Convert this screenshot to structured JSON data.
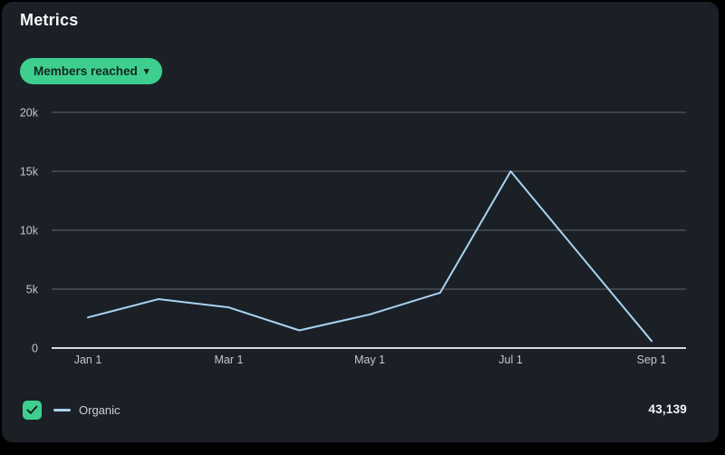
{
  "page": {
    "background": "#000000"
  },
  "panel": {
    "background": "#1B2027",
    "title": "Metrics"
  },
  "filter_button": {
    "label": "Members reached",
    "chevron": "▾",
    "background": "#3ECF8E",
    "text_color": "#15271E"
  },
  "chart_data": {
    "type": "line",
    "x": [
      "Jan 1",
      "Feb 1",
      "Mar 1",
      "Apr 1",
      "May 1",
      "Jun 1",
      "Jul 1",
      "Aug 1",
      "Sep 1"
    ],
    "series": [
      {
        "name": "Organic",
        "color": "#A9D3F0",
        "values": [
          2600,
          4150,
          3450,
          1500,
          2850,
          4700,
          15000,
          7800,
          600
        ]
      }
    ],
    "ylim": [
      0,
      20000
    ],
    "yticks": {
      "values": [
        0,
        5000,
        10000,
        15000,
        20000
      ],
      "labels": [
        "0",
        "5k",
        "10k",
        "15k",
        "20k"
      ]
    },
    "x_tick_labels": [
      "Jan 1",
      "Mar 1",
      "May 1",
      "Jul 1",
      "Sep 1"
    ],
    "x_tick_indices": [
      0,
      2,
      4,
      6,
      8
    ],
    "grid": "horizontal",
    "gridline_color": "#60666D",
    "baseline_color": "#D7DBDF",
    "tick_label_color": "#C2C7CD",
    "legend_position": "bottom"
  },
  "legend": {
    "checkbox_checked": true,
    "checkbox_color": "#3ECF8E",
    "checkmark_color": "#12241B",
    "series_label": "Organic",
    "swatch_color": "#A9D3F0",
    "total_value": "43,139"
  }
}
